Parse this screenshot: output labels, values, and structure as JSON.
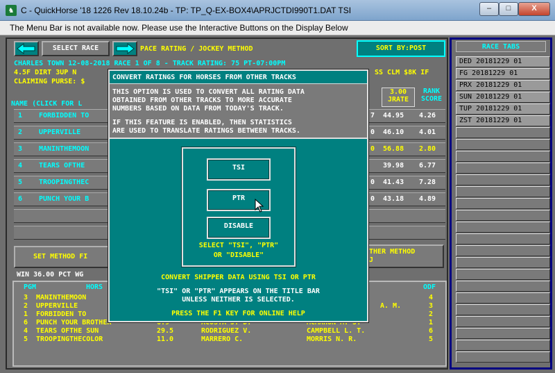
{
  "window": {
    "title": "C - QuickHorse '18 1226 Rev 18.10.24b - TP: TP_Q-EX-BOX4\\APRJCTDI990T1.DAT TSI",
    "min_label": "–",
    "max_label": "□",
    "close_label": "X"
  },
  "menubar": {
    "notice": "The Menu Bar is not available now.  Please use the Interactive Buttons on the Display Below"
  },
  "toolbar": {
    "select_race_label": "SELECT RACE",
    "mode_label": "PACE RATING / JOCKEY METHOD",
    "sort_label": "SORT BY:POST"
  },
  "race_info": {
    "line1": "CHARLES TOWN 12-08-2018 RACE 1 OF 8 - TRACK RATING: 75 PT-07:00PM",
    "line2_left": "4.5F DIRT 3UP N",
    "line2_right": "SS CLM $8K IF",
    "line3_left": "CLAIMING PURSE: $"
  },
  "columns": {
    "name_header": "NAME (CLICK FOR L",
    "jrate_header_1": "3.00",
    "jrate_header_2": "JRATE",
    "rank_header_1": "RANK",
    "rank_header_2": "SCORE"
  },
  "entries": [
    {
      "pgm": "1",
      "name": "FORBIDDEN TO",
      "frag": "7",
      "jrate": "44.95",
      "rank": "4.26"
    },
    {
      "pgm": "2",
      "name": "UPPERVILLE",
      "frag": "0",
      "jrate": "46.10",
      "rank": "4.01"
    },
    {
      "pgm": "3",
      "name": "MANINTHEMOON",
      "frag": "0",
      "jrate": "56.88",
      "rank": "2.80"
    },
    {
      "pgm": "4",
      "name": "TEARS OFTHE",
      "frag": "",
      "jrate": "39.98",
      "rank": "6.77"
    },
    {
      "pgm": "5",
      "name": "TROOPINGTHEC",
      "frag": "0",
      "jrate": "41.43",
      "rank": "7.28"
    },
    {
      "pgm": "6",
      "name": "PUNCH YOUR B",
      "frag": "0",
      "jrate": "43.18",
      "rank": "4.89"
    }
  ],
  "bottom": {
    "set_method_label": "SET METHOD FI",
    "other_method_1": "OTHER METHOD",
    "other_method_2": "RJ",
    "win_pct": "WIN 36.00 PCT WG",
    "pgm_header": "PGM",
    "horse_header": "HORS",
    "odf_header": "ODF"
  },
  "results": [
    {
      "pgm": "3",
      "horse": "MANINTHEMOON",
      "odds": "",
      "jockey": "",
      "trainer": "",
      "odf": "4"
    },
    {
      "pgm": "2",
      "horse": "UPPERVILLE",
      "odds": "",
      "jockey": "",
      "trainer": "A. M.",
      "odf": "3"
    },
    {
      "pgm": "1",
      "horse": "FORBIDDEN TO",
      "odds": "",
      "jockey": "",
      "trainer": "",
      "odf": "2"
    },
    {
      "pgm": "6",
      "horse": "PUNCH YOUR BROTHER",
      "odds": "6.9",
      "jockey": "ACOSTA J. D.",
      "trainer": "MCMAHON M. J.",
      "odf": "1"
    },
    {
      "pgm": "4",
      "horse": "TEARS OFTHE SUN",
      "odds": "29.5",
      "jockey": "RODRIGUEZ V.",
      "trainer": "CAMPBELL L. T.",
      "odf": "6"
    },
    {
      "pgm": "5",
      "horse": "TROOPINGTHECOLOR",
      "odds": "11.0",
      "jockey": "MARRERO C.",
      "trainer": "MORRIS N. R.",
      "odf": "5"
    }
  ],
  "race_tabs": {
    "header": "RACE TABS",
    "tabs": [
      "DED 20181229 01",
      "FG  20181229 01",
      "PRX 20181229 01",
      "SUN 20181229 01",
      "TUP 20181229 01",
      "ZST 20181229 01"
    ]
  },
  "dialog": {
    "title": "CONVERT RATINGS FOR HORSES FROM OTHER TRACKS",
    "para1_l1": "THIS OPTION IS USED TO CONVERT ALL RATING DATA",
    "para1_l2": "OBTAINED FROM OTHER TRACKS TO MORE ACCURATE",
    "para1_l3": "NUMBERS BASED ON DATA FROM TODAY'S TRACK.",
    "para2_l1": "IF THIS FEATURE IS ENABLED, THEN STATISTICS",
    "para2_l2": "ARE USED TO TRANSLATE RATINGS BETWEEN TRACKS.",
    "btn_tsi": "TSI",
    "btn_ptr": "PTR",
    "btn_disable": "DISABLE",
    "select_l1": "SELECT \"TSI\", \"PTR\"",
    "select_l2": "OR \"DISABLE\"",
    "convert_line": "CONVERT SHIPPER DATA USING TSI OR PTR",
    "appears_l1": "\"TSI\" OR \"PTR\" APPEARS ON THE TITLE BAR",
    "appears_l2": "UNLESS NEITHER IS SELECTED.",
    "help_line": "PRESS THE F1 KEY FOR ONLINE HELP"
  }
}
